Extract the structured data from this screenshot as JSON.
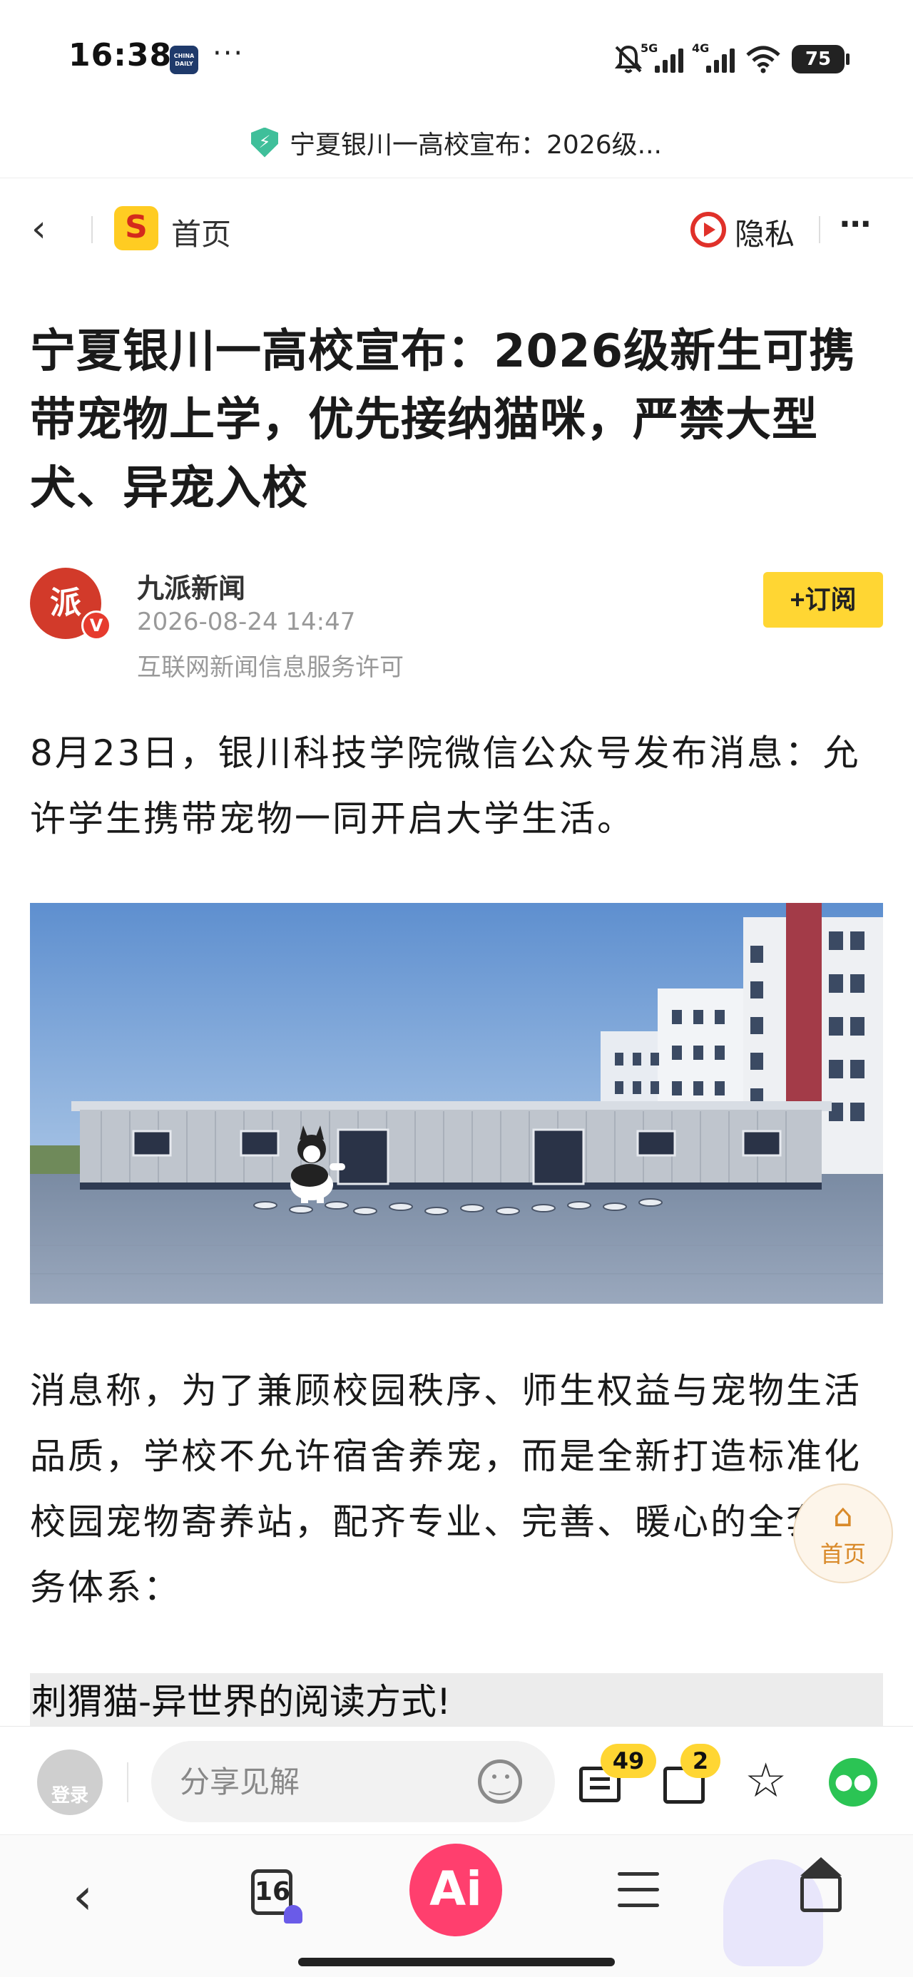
{
  "status_bar": {
    "time": "16:38",
    "app_badge_text": "CHINA DAILY",
    "more": "···",
    "network_5g": "5G",
    "network_4g": "4G",
    "battery": "75"
  },
  "address_bar": {
    "url_text": "宁夏银川一高校宣布：2026级..."
  },
  "nav": {
    "home_label": "首页",
    "privacy_label": "隐私",
    "more_label": "···"
  },
  "article": {
    "title": "宁夏银川一高校宣布：2026级新生可携带宠物上学，优先接纳猫咪，严禁大型犬、异宠入校",
    "author": {
      "name": "九派新闻",
      "avatar_text": "派",
      "verified_text": "V",
      "time": "2026-08-24 14:47",
      "license": "互联网新闻信息服务许可"
    },
    "subscribe_label": "+订阅",
    "paragraph_1": "8月23日，银川科技学院微信公众号发布消息：允许学生携带宠物一同开启大学生活。",
    "paragraph_2": "消息称，为了兼顾校园秩序、师生权益与宠物生活品质，学校不允许宿舍养宠，而是全新打造标准化校园宠物寄养站，配齐专业、完善、暖心的全套服务体系：",
    "promo_text": "刺猬猫-异世界的阅读方式!"
  },
  "floating_home": {
    "label": "首页"
  },
  "comment_bar": {
    "login_label": "登录",
    "input_placeholder": "分享见解",
    "comment_count": "49",
    "like_count": "2"
  },
  "bottom_nav": {
    "tab_count": "16",
    "ai_label": "Ai"
  },
  "colors": {
    "accent_yellow": "#ffd633",
    "ai_pink": "#ff3f6e",
    "wechat_green": "#2bc454",
    "brand_red": "#d23a2a"
  }
}
